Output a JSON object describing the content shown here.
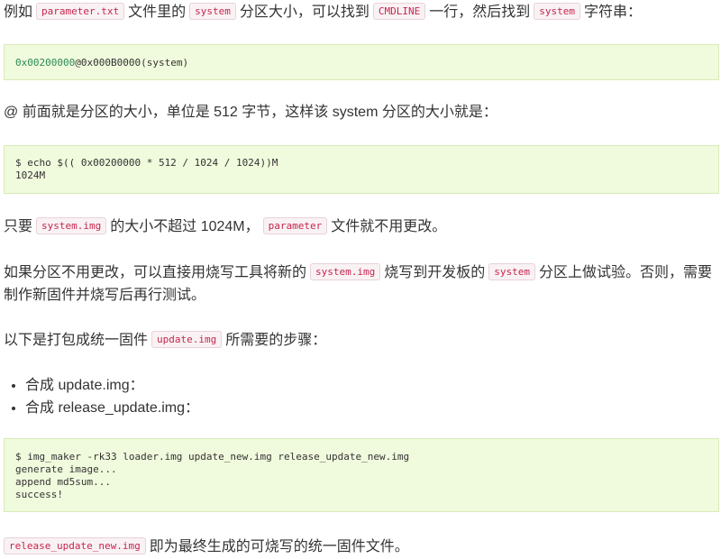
{
  "para1": {
    "t1": "例如",
    "c1": "parameter.txt",
    "t2": "文件里的",
    "c2": "system",
    "t3": "分区大小，可以找到",
    "c3": "CMDLINE",
    "t4": "一行，然后找到",
    "c4": "system",
    "t5": "字符串："
  },
  "code1": {
    "size_hex": "0x00200000",
    "rest": "@0x000B0000(system)"
  },
  "para2": "@ 前面就是分区的大小，单位是 512 字节，这样该 system 分区的大小就是：",
  "code2": {
    "lines": [
      "$ echo $(( 0x00200000 * 512 / 1024 / 1024))M",
      "1024M"
    ]
  },
  "para3": {
    "t1": "只要",
    "c1": "system.img",
    "t2": "的大小不超过 1024M，",
    "c2": "parameter",
    "t3": "文件就不用更改。"
  },
  "para4": {
    "t1": "如果分区不用更改，可以直接用烧写工具将新的",
    "c1": "system.img",
    "t2": "烧写到开发板的",
    "c2": "system",
    "t3": "分区上做试验。否则，需要",
    "line2": "制作新固件并烧写后再行测试。"
  },
  "para5": {
    "t1": "以下是打包成统一固件",
    "c1": "update.img",
    "t2": "所需要的步骤："
  },
  "list": [
    "合成 update.img：",
    "合成 release_update.img："
  ],
  "code3": {
    "lines": [
      "$ img_maker -rk33 loader.img update_new.img release_update_new.img",
      "generate image...",
      "append md5sum...",
      "success!"
    ]
  },
  "para6": {
    "c1": "release_update_new.img",
    "t1": "即为最终生成的可烧写的统一固件文件。"
  }
}
